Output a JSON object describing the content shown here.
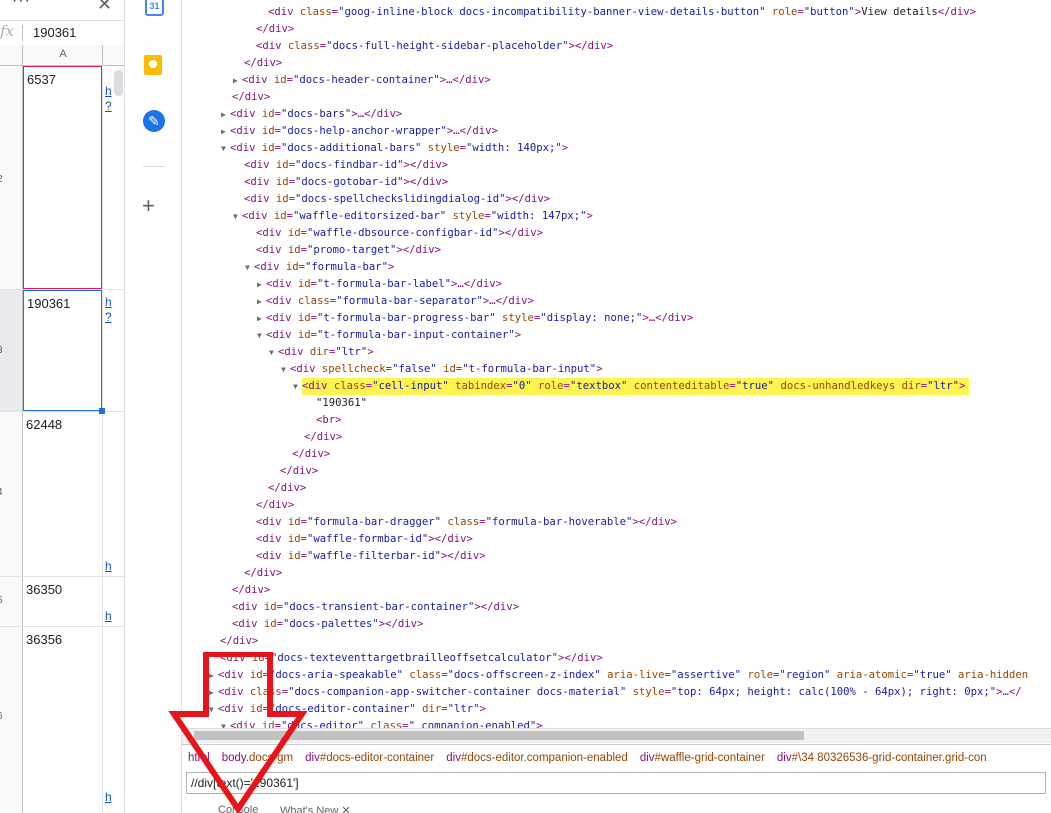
{
  "sheet": {
    "formula_value": "190361",
    "fx_label": "fx",
    "column_label": "A",
    "rows": [
      {
        "num": "2",
        "value": "6537",
        "link": "h\n?"
      },
      {
        "num": "3",
        "value": "190361",
        "link": "h\n?"
      },
      {
        "num": "4",
        "value": "62448",
        "link": "h"
      },
      {
        "num": "5",
        "value": "36350",
        "link": "h"
      },
      {
        "num": "6",
        "value": "36356",
        "link": "h"
      }
    ],
    "colors": {
      "selected_border": "#1a73e8",
      "alt_border": "#e8175d"
    }
  },
  "side_panel": {
    "items": [
      {
        "label": "Calendar",
        "icon": "calendar-icon",
        "text": "31"
      },
      {
        "label": "Keep",
        "icon": "keep-icon"
      },
      {
        "label": "Tasks",
        "icon": "tasks-icon"
      },
      {
        "label": "Add-ons",
        "icon": "plus-icon",
        "text": "+"
      }
    ]
  },
  "devtools": {
    "breadcrumbs": [
      {
        "tag": "html",
        "cls": ""
      },
      {
        "tag": "body",
        "cls": ".docs-gm"
      },
      {
        "tag": "div",
        "cls": "#docs-editor-container"
      },
      {
        "tag": "div",
        "cls": "#docs-editor.companion-enabled"
      },
      {
        "tag": "div",
        "cls": "#waffle-grid-container"
      },
      {
        "tag": "div",
        "cls": "#\\34 80326536-grid-container.grid-con"
      }
    ],
    "xpath_query": "//div[text()='190361']",
    "bottom_tabs": [
      "Console",
      "What's New ✕"
    ]
  }
}
